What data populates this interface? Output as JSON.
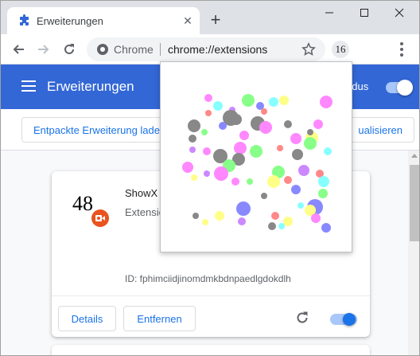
{
  "tab": {
    "title": "Erweiterungen",
    "close_glyph": "✕",
    "icon": "puzzle-icon"
  },
  "new_tab_glyph": "+",
  "omnibox": {
    "chip": "Chrome",
    "url": "chrome://extensions"
  },
  "extension_badge": "16",
  "header": {
    "title": "Erweiterungen",
    "devmode_label": "odus",
    "devmode_on": true
  },
  "subbar": {
    "load_unpacked": "Entpackte Erweiterung lade",
    "update": "ualisieren"
  },
  "extension": {
    "icon_number": "48",
    "name": "ShowX",
    "description": "Extensio",
    "id_text": "ID: fphimciidjinomdmkbdnpaedlgdokdlh",
    "details_label": "Details",
    "remove_label": "Entfernen",
    "enabled": true
  },
  "colors": {
    "accent": "#3367d6",
    "link": "#1a73e8",
    "record": "#e8531f"
  },
  "popup_dot_colors": [
    "#ff88ff",
    "#888888",
    "#88ff88",
    "#8888ff",
    "#88ffff",
    "#ffff88",
    "#ff8888",
    "#cc88ff"
  ]
}
